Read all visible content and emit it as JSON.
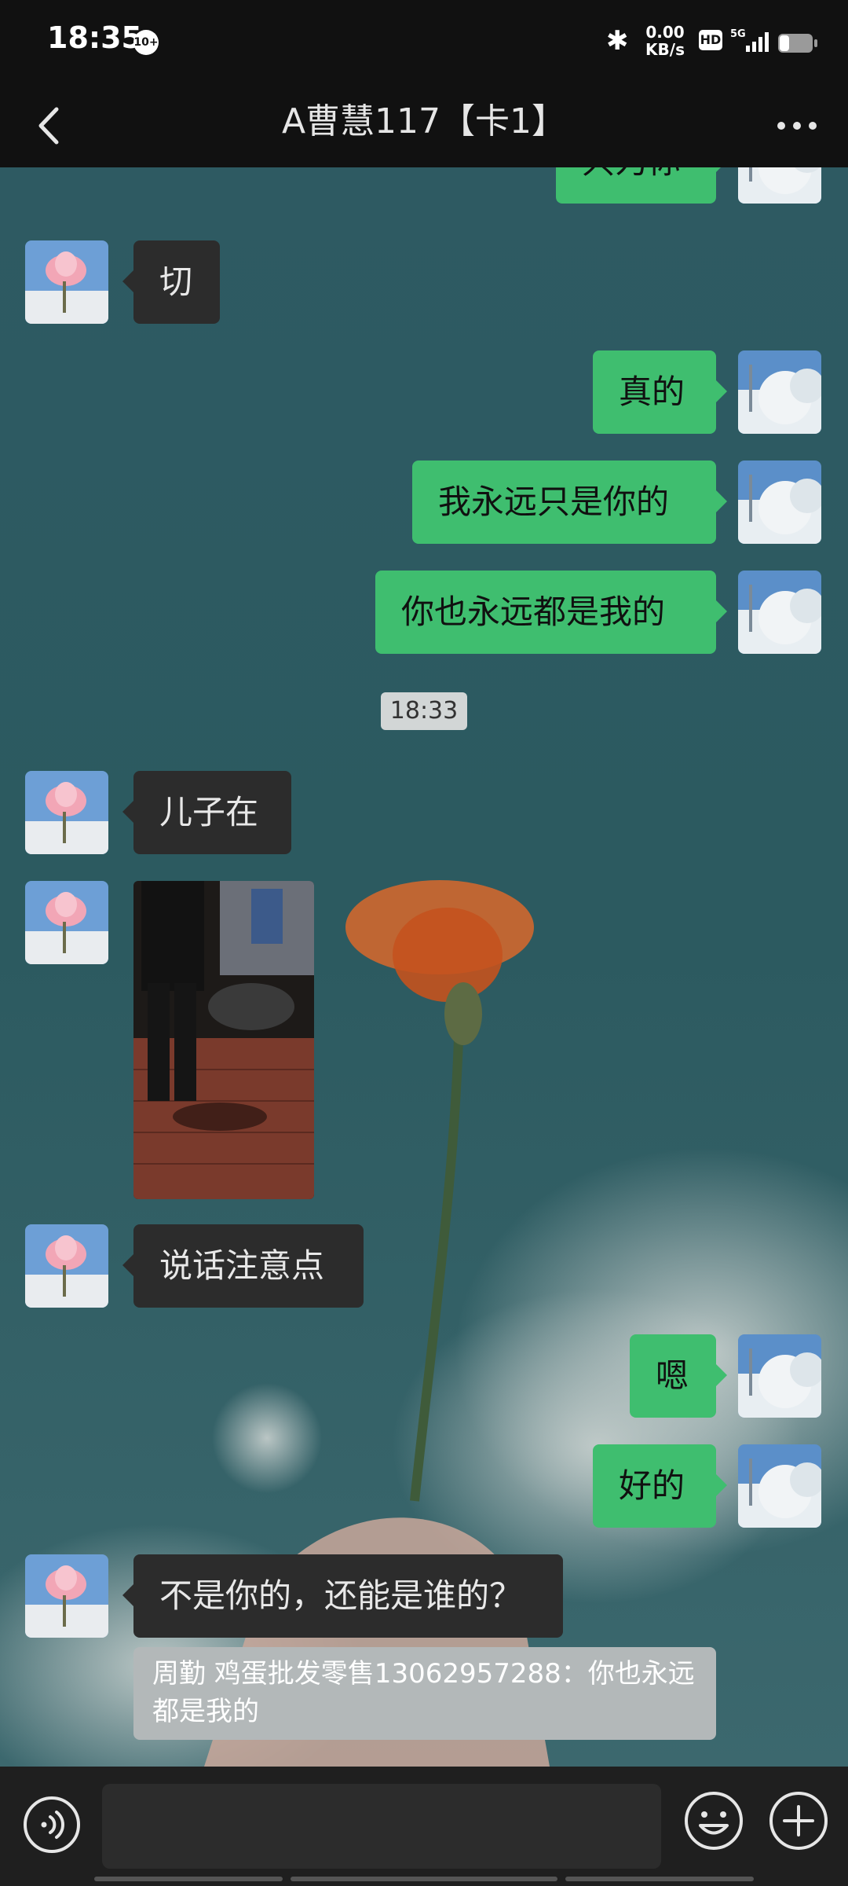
{
  "status_bar": {
    "time": "18:35",
    "notification_badge": "10+",
    "net_speed_value": "0.00",
    "net_speed_unit": "KB/s",
    "hd_label": "HD",
    "network_label": "5G"
  },
  "header": {
    "title": "A曹慧117【卡1】"
  },
  "messages": [
    {
      "side": "out",
      "text": "只为你"
    },
    {
      "side": "in",
      "text": "切"
    },
    {
      "side": "out",
      "text": "真的"
    },
    {
      "side": "out",
      "text": "我永远只是你的"
    },
    {
      "side": "out",
      "text": "你也永远都是我的"
    },
    {
      "side": "time",
      "text": "18:33"
    },
    {
      "side": "in",
      "text": "儿子在"
    },
    {
      "side": "in",
      "type": "image",
      "text": ""
    },
    {
      "side": "in",
      "text": "说话注意点"
    },
    {
      "side": "out",
      "text": "嗯"
    },
    {
      "side": "out",
      "text": "好的"
    },
    {
      "side": "in",
      "text": "不是你的，还能是谁的？"
    }
  ],
  "quote": {
    "text": "周勤 鸡蛋批发零售13062957288：你也永远都是我的"
  },
  "colors": {
    "outgoing_bubble": "#3fbe6f",
    "incoming_bubble": "#2c2c2c",
    "bar_background": "#111111"
  },
  "icons": {
    "back": "chevron-left-icon",
    "more": "more-dots-icon",
    "voice": "voice-icon",
    "emoji": "emoji-icon",
    "plus": "plus-icon"
  }
}
